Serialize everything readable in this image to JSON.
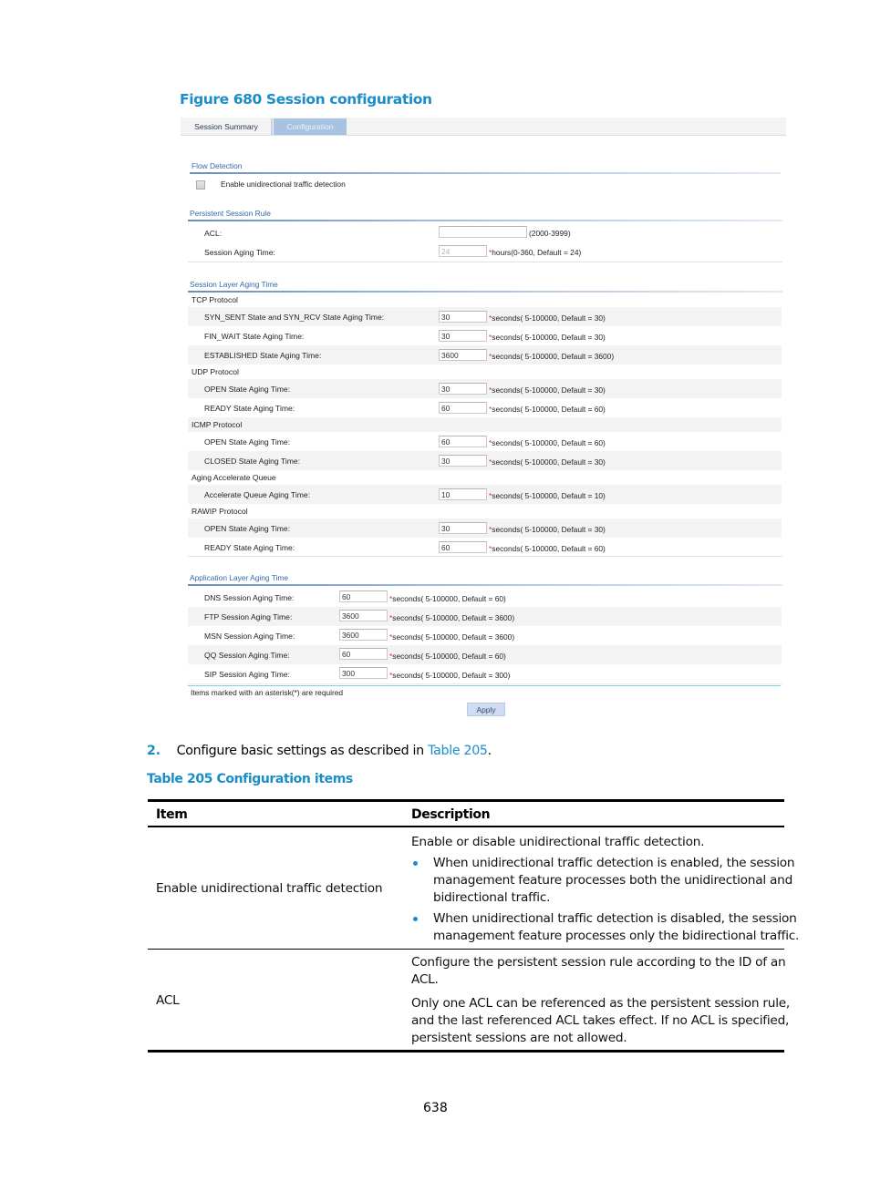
{
  "figure_title": "Figure 680 Session configuration",
  "tabs": [
    {
      "label": "Session Summary",
      "active": false
    },
    {
      "label": "Configuration",
      "active": true
    }
  ],
  "flow_detection": {
    "title": "Flow Detection",
    "checkbox_label": "Enable unidirectional traffic detection",
    "checked": false
  },
  "persistent_rule": {
    "title": "Persistent Session Rule",
    "acl": {
      "label": "ACL:",
      "value": "",
      "hint": "(2000-3999)"
    },
    "aging": {
      "label": "Session Aging Time:",
      "value": "24",
      "hint": "hours(0-360, Default = 24)"
    }
  },
  "session_layer": {
    "title": "Session Layer Aging Time",
    "groups": [
      {
        "name": "TCP Protocol",
        "rows": [
          {
            "label": "SYN_SENT State and SYN_RCV State Aging Time:",
            "value": "30",
            "hint": "seconds( 5-100000, Default = 30)"
          },
          {
            "label": "FIN_WAIT State Aging Time:",
            "value": "30",
            "hint": "seconds( 5-100000, Default = 30)"
          },
          {
            "label": "ESTABLISHED State Aging Time:",
            "value": "3600",
            "hint": "seconds( 5-100000, Default = 3600)"
          }
        ]
      },
      {
        "name": "UDP Protocol",
        "rows": [
          {
            "label": "OPEN State Aging Time:",
            "value": "30",
            "hint": "seconds( 5-100000, Default = 30)"
          },
          {
            "label": "READY State Aging Time:",
            "value": "60",
            "hint": "seconds( 5-100000, Default = 60)"
          }
        ]
      },
      {
        "name": "ICMP Protocol",
        "rows": [
          {
            "label": "OPEN State Aging Time:",
            "value": "60",
            "hint": "seconds( 5-100000, Default = 60)"
          },
          {
            "label": "CLOSED State Aging Time:",
            "value": "30",
            "hint": "seconds( 5-100000, Default = 30)"
          }
        ]
      },
      {
        "name": "Aging Accelerate Queue",
        "rows": [
          {
            "label": "Accelerate Queue Aging Time:",
            "value": "10",
            "hint": "seconds( 5-100000, Default = 10)"
          }
        ]
      },
      {
        "name": "RAWIP Protocol",
        "rows": [
          {
            "label": "OPEN State Aging Time:",
            "value": "30",
            "hint": "seconds( 5-100000, Default = 30)"
          },
          {
            "label": "READY State Aging Time:",
            "value": "60",
            "hint": "seconds( 5-100000, Default = 60)"
          }
        ]
      }
    ]
  },
  "app_layer": {
    "title": "Application Layer Aging Time",
    "rows": [
      {
        "label": "DNS Session Aging Time:",
        "value": "60",
        "hint": "seconds( 5-100000, Default = 60)"
      },
      {
        "label": "FTP Session Aging Time:",
        "value": "3600",
        "hint": "seconds( 5-100000, Default = 3600)"
      },
      {
        "label": "MSN Session Aging Time:",
        "value": "3600",
        "hint": "seconds( 5-100000, Default = 3600)"
      },
      {
        "label": "QQ Session Aging Time:",
        "value": "60",
        "hint": "seconds( 5-100000, Default = 60)"
      },
      {
        "label": "SIP Session Aging Time:",
        "value": "300",
        "hint": "seconds( 5-100000, Default = 300)"
      }
    ]
  },
  "required_note": "Items marked with an asterisk(*) are required",
  "asterisk": "*",
  "apply_label": "Apply",
  "step": {
    "number": "2.",
    "text": "Configure basic settings as described in ",
    "link": "Table 205",
    "suffix": "."
  },
  "table": {
    "title": "Table 205 Configuration items",
    "headers": [
      "Item",
      "Description"
    ],
    "rows": [
      {
        "item": "Enable unidirectional traffic detection",
        "desc_intro": "Enable or disable unidirectional traffic detection.",
        "bullets": [
          [
            "When unidirectional traffic detection is enabled, the session",
            "management feature processes both the unidirectional and",
            "bidirectional traffic."
          ],
          [
            "When unidirectional traffic detection is disabled, the session",
            "management feature processes only the bidirectional traffic."
          ]
        ]
      },
      {
        "item": "ACL",
        "paragraphs": [
          [
            "Configure the persistent session rule according to the ID of an",
            "ACL."
          ],
          [
            "Only one ACL can be referenced as the persistent session rule,",
            "and the last referenced ACL takes effect. If no ACL is specified,",
            "persistent sessions are not allowed."
          ]
        ]
      }
    ]
  },
  "page_number": "638",
  "colors": {
    "accent": "#1a8dc8",
    "tab_active": "#a8c2e2",
    "row_shade": "#f3f3f3",
    "required": "#e03030"
  }
}
